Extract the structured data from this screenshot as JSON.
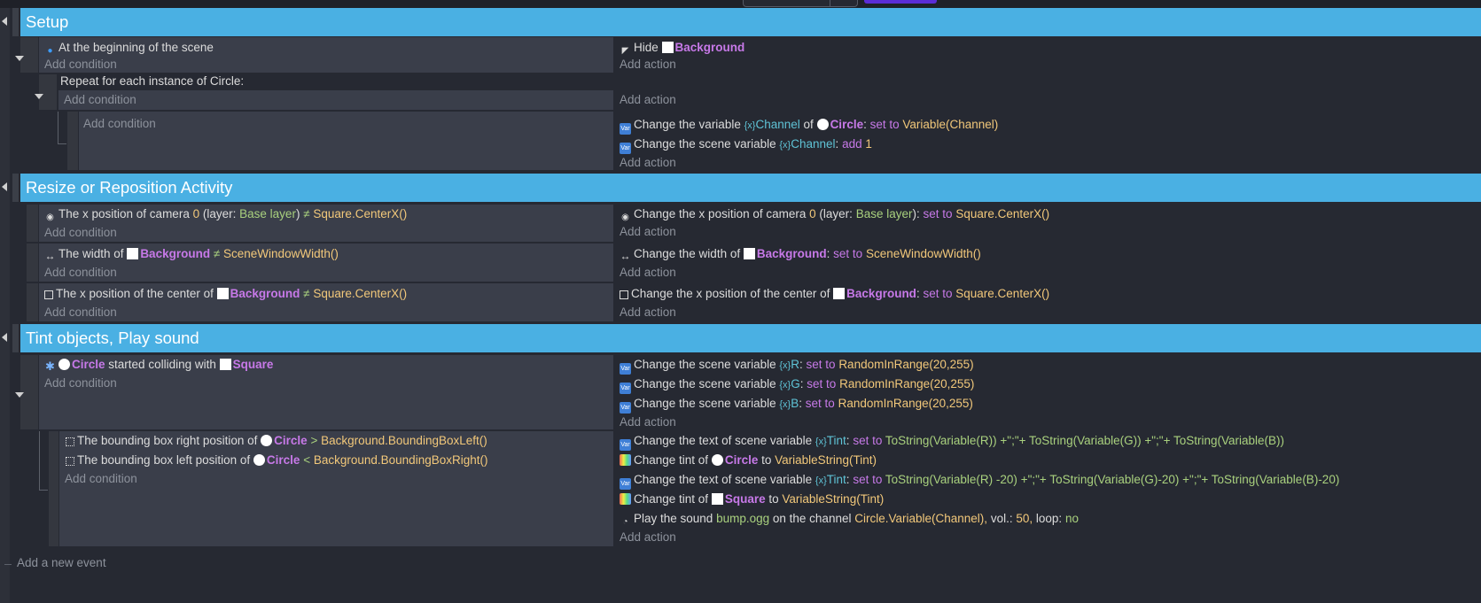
{
  "groups": [
    {
      "title": "Setup"
    },
    {
      "title": "Resize or Reposition Activity"
    },
    {
      "title": "Tint objects, Play sound"
    }
  ],
  "common": {
    "add_condition": "Add condition",
    "add_action": "Add action",
    "add_event": "Add a new event",
    "op_set": "set to",
    "op_add": "add",
    "op_neq": "≠",
    "op_gt": ">",
    "op_lt": "<",
    "colon": ":",
    "plus_sep": "+\";\"+"
  },
  "objects": {
    "background": "Background",
    "circle": "Circle",
    "square": "Square"
  },
  "e1": {
    "cond": "At the beginning of the scene",
    "hide": "Hide"
  },
  "e2": {
    "repeat": "Repeat for each instance of Circle:"
  },
  "e3": {
    "a1_pre": "Change the variable",
    "a1_var": "Channel",
    "a1_of": "of",
    "a1_val": "Variable(Channel)",
    "a2_pre": "Change the scene variable",
    "a2_var": "Channel",
    "a2_val": "1"
  },
  "e4": {
    "cond_pre": "The x position of camera",
    "cam": "0",
    "layer_open": "(layer:",
    "layer": "Base layer",
    "layer_close": ")",
    "val": "Square.CenterX()",
    "act_pre": "Change the x position of camera",
    "act_layer_close": "):"
  },
  "e5": {
    "cond_pre": "The width of",
    "val": "SceneWindowWidth()",
    "act_pre": "Change the width of"
  },
  "e6": {
    "cond_pre": "The x position of the center of",
    "val": "Square.CenterX()",
    "act_pre": "Change the x position of the center of"
  },
  "e7": {
    "cond_mid": "started colliding with",
    "a_pre": "Change the scene variable",
    "vars": [
      "R",
      "G",
      "B"
    ],
    "val": "RandomInRange(20,255)"
  },
  "e8": {
    "c1": "The bounding box right position of",
    "c1_val": "Background.BoundingBoxLeft()",
    "c2": "The bounding box left position of",
    "c2_val": "Background.BoundingBoxRight()",
    "a1_pre": "Change the text of scene variable",
    "tint_var": "Tint",
    "a1_v1": "ToString(Variable(R))",
    "a1_v2": "ToString(Variable(G))",
    "a1_v3": "ToString(Variable(B))",
    "tint_pre": "Change tint of",
    "to": "to",
    "tint_val": "VariableString(Tint)",
    "a3_v1": "ToString(Variable(R) -20)",
    "a3_v2": "ToString(Variable(G)-20)",
    "a3_v3": "ToString(Variable(B)-20)",
    "snd_pre": "Play the sound",
    "snd_file": "bump.ogg",
    "snd_mid": "on the channel",
    "snd_ch": "Circle.Variable(Channel),",
    "snd_vol_lbl": "vol.:",
    "snd_vol": "50,",
    "snd_loop_lbl": "loop:",
    "snd_loop": "no"
  },
  "colors": {
    "group_header": "#4ab0e3",
    "condition_bg": "#3a3e4a",
    "page_bg": "#262932",
    "object": "#c779e8",
    "value": "#f2c87a",
    "variable": "#5fc3d6"
  }
}
